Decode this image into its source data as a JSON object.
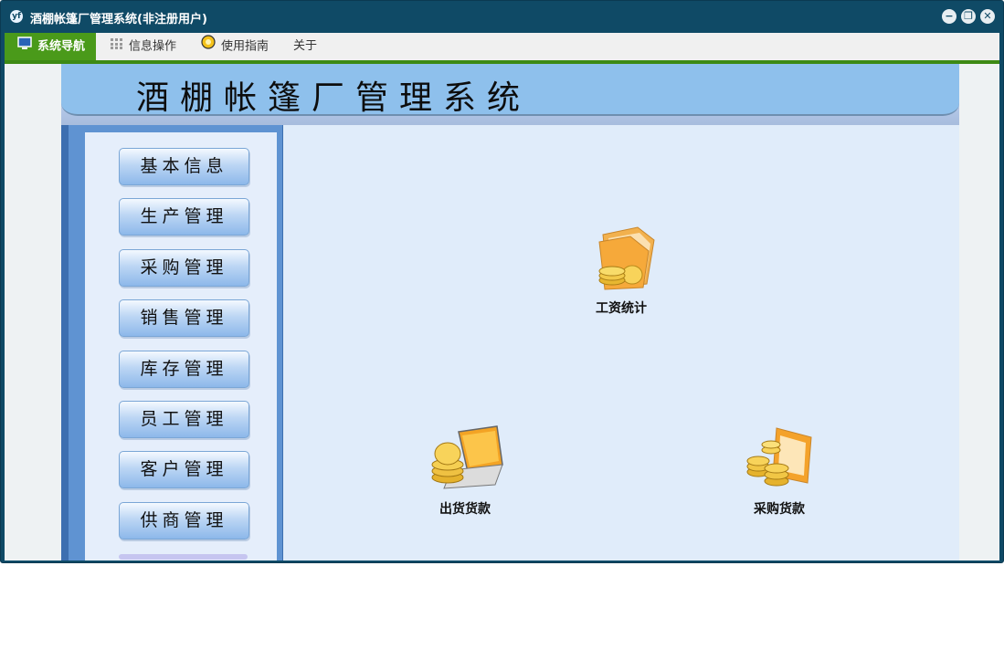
{
  "window": {
    "logo": "yf",
    "title": "酒棚帐篷厂管理系统(非注册用户)",
    "controls": {
      "minimize": "−",
      "restore": "❐",
      "close": "✕"
    }
  },
  "menu": {
    "items": [
      {
        "label": "系统导航",
        "icon": "monitor-icon",
        "active": true
      },
      {
        "label": "信息操作",
        "icon": "grid-icon"
      },
      {
        "label": "使用指南",
        "icon": "help-icon"
      },
      {
        "label": "关于"
      }
    ]
  },
  "banner": {
    "title": "酒棚帐篷厂管理系统"
  },
  "sidebar": {
    "buttons": [
      "基本信息",
      "生产管理",
      "采购管理",
      "销售管理",
      "库存管理",
      "员工管理",
      "客户管理",
      "供商管理"
    ]
  },
  "tiles": [
    {
      "label": "工资统计",
      "icon": "folder-coins-icon"
    },
    {
      "label": "出货货款",
      "icon": "laptop-coins-icon"
    },
    {
      "label": "采购货款",
      "icon": "coins-stack-icon"
    }
  ],
  "colors": {
    "title_bar": "#0f4a66",
    "menu_active": "#4a9a1a",
    "banner": "#8ec0ec",
    "sidebar": "#5f93d2",
    "main_bg": "#e0ecfa"
  }
}
